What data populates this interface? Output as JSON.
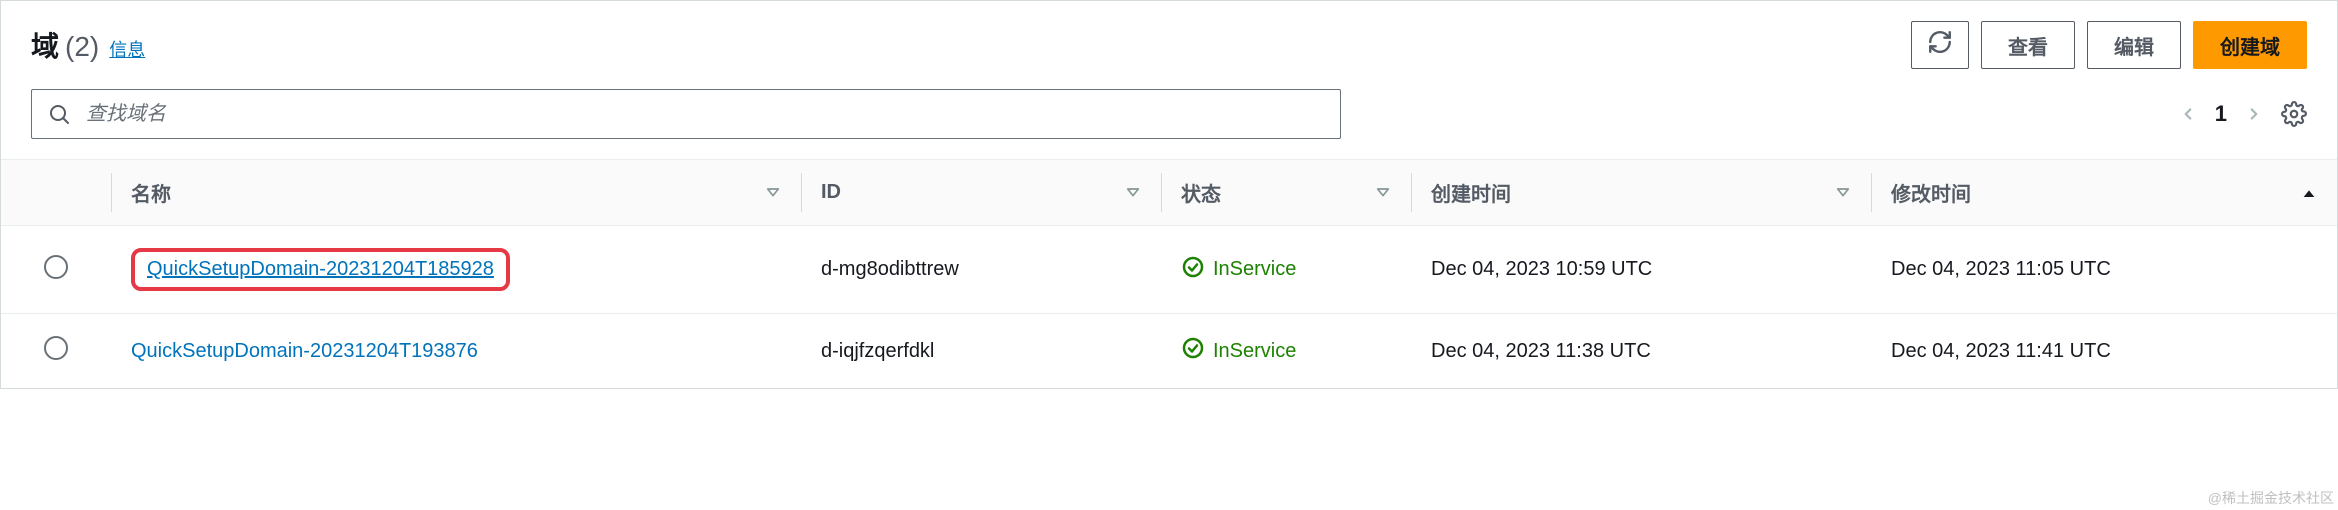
{
  "header": {
    "title": "域",
    "count": "(2)",
    "info_link": "信息"
  },
  "actions": {
    "view": "查看",
    "edit": "编辑",
    "create": "创建域"
  },
  "search": {
    "placeholder": "查找域名"
  },
  "pagination": {
    "current": "1"
  },
  "columns": {
    "name": "名称",
    "id": "ID",
    "status": "状态",
    "created": "创建时间",
    "modified": "修改时间"
  },
  "rows": [
    {
      "name": "QuickSetupDomain-20231204T185928",
      "id": "d-mg8odibttrew",
      "status": "InService",
      "created": "Dec 04, 2023 10:59 UTC",
      "modified": "Dec 04, 2023 11:05 UTC",
      "highlighted": true
    },
    {
      "name": "QuickSetupDomain-20231204T193876",
      "id": "d-iqjfzqerfdkl",
      "status": "InService",
      "created": "Dec 04, 2023 11:38 UTC",
      "modified": "Dec 04, 2023 11:41 UTC",
      "highlighted": false
    }
  ],
  "watermark": "@稀土掘金技术社区"
}
